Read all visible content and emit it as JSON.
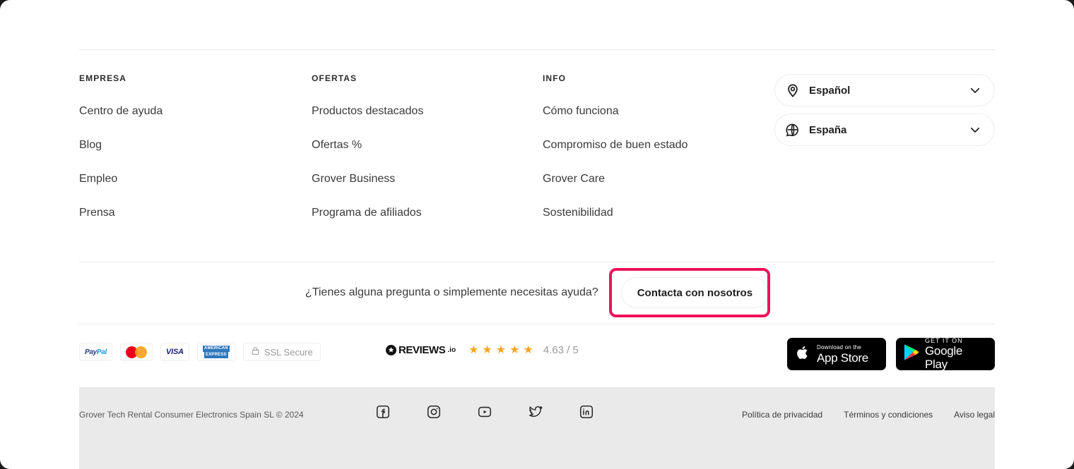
{
  "footer": {
    "columns": [
      {
        "heading": "EMPRESA",
        "links": [
          "Centro de ayuda",
          "Blog",
          "Empleo",
          "Prensa"
        ]
      },
      {
        "heading": "OFERTAS",
        "links": [
          "Productos destacados",
          "Ofertas %",
          "Grover Business",
          "Programa de afiliados"
        ]
      },
      {
        "heading": "INFO",
        "links": [
          "Cómo funciona",
          "Compromiso de buen estado",
          "Grover Care",
          "Sostenibilidad"
        ]
      }
    ],
    "selectors": [
      {
        "icon": "location-pin-icon",
        "value": "Español",
        "chevron": "chevron-down-icon"
      },
      {
        "icon": "language-globe-icon",
        "value": "España",
        "chevron": "chevron-down-icon"
      }
    ],
    "contact": {
      "question": "¿Tienes alguna pregunta o simplemente necesitas ayuda?",
      "button_label": "Contacta con nosotros",
      "highlight_color": "#F0115A"
    },
    "payments": [
      {
        "name": "paypal-icon",
        "label_a": "Pay",
        "label_b": "Pal"
      },
      {
        "name": "mastercard-icon",
        "label": ""
      },
      {
        "name": "visa-icon",
        "label": "VISA"
      },
      {
        "name": "amex-icon",
        "line1": "AMERICAN",
        "line2": "EXPRESS"
      },
      {
        "name": "ssl-secure-badge",
        "label": "SSL Secure"
      }
    ],
    "reviews": {
      "brand": "REVIEWS",
      "brand_suffix": ".io",
      "stars": 5,
      "star_color": "#F5A623",
      "rating_text": "4.63 / 5"
    },
    "app_stores": [
      {
        "name": "app-store-badge",
        "line1": "Download on the",
        "line2": "App Store"
      },
      {
        "name": "google-play-badge",
        "line1": "GET IT ON",
        "line2": "Google Play"
      }
    ],
    "copyright": "Grover Tech Rental Consumer Electronics Spain SL © 2024",
    "socials": [
      "facebook-icon",
      "instagram-icon",
      "youtube-icon",
      "twitter-icon",
      "linkedin-icon"
    ],
    "legal_links": [
      "Política de privacidad",
      "Términos y condiciones",
      "Aviso legal"
    ]
  }
}
